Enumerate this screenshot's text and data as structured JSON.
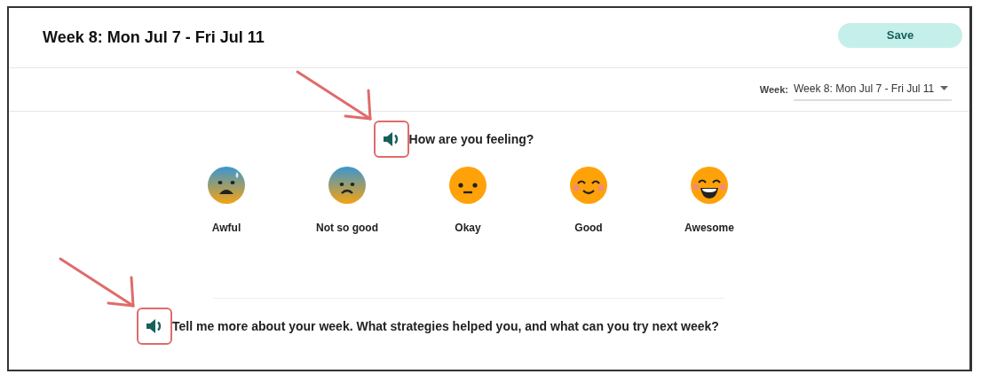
{
  "header": {
    "title": "Week 8: Mon Jul 7 - Fri Jul 11",
    "save_button": "Save"
  },
  "week_filter": {
    "label": "Week:",
    "value": "Week 8: Mon Jul 7 - Fri Jul 11"
  },
  "mood_question": {
    "text": "How are you feeling?",
    "highlighted": true
  },
  "moods": [
    {
      "kind": "awful",
      "label": "Awful",
      "selected": false
    },
    {
      "kind": "not-so-good",
      "label": "Not so good",
      "selected": false
    },
    {
      "kind": "okay",
      "label": "Okay",
      "selected": false
    },
    {
      "kind": "good",
      "label": "Good",
      "selected": false
    },
    {
      "kind": "awesome",
      "label": "Awesome",
      "selected": false
    }
  ],
  "reflection_question": {
    "text": "Tell me more about your week. What strategies helped you, and what can you try next week?",
    "highlighted": true
  }
}
